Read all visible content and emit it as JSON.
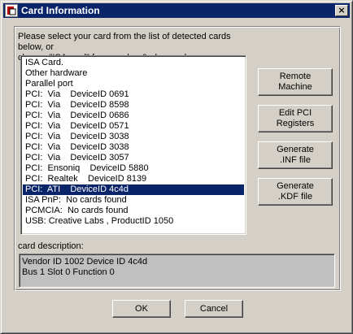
{
  "window": {
    "title": "Card Information",
    "close_glyph": "×",
    "icon": "app-icon",
    "colors": {
      "titlebar": "#0a246a",
      "selection": "#0a246a",
      "face": "#d4d0c8"
    }
  },
  "instructions": "Please select your card from the list of detected cards below, or\nchoose \"ISA card\" for non plug & play cards.",
  "cards": [
    {
      "label": "ISA Card.",
      "selected": false
    },
    {
      "label": "Other hardware",
      "selected": false
    },
    {
      "label": "Parallel port",
      "selected": false
    },
    {
      "label": "PCI:  Via    DeviceID 0691",
      "selected": false
    },
    {
      "label": "PCI:  Via    DeviceID 8598",
      "selected": false
    },
    {
      "label": "PCI:  Via    DeviceID 0686",
      "selected": false
    },
    {
      "label": "PCI:  Via    DeviceID 0571",
      "selected": false
    },
    {
      "label": "PCI:  Via    DeviceID 3038",
      "selected": false
    },
    {
      "label": "PCI:  Via    DeviceID 3038",
      "selected": false
    },
    {
      "label": "PCI:  Via    DeviceID 3057",
      "selected": false
    },
    {
      "label": "PCI:  Ensoniq    DeviceID 5880",
      "selected": false
    },
    {
      "label": "PCI:  Realtek    DeviceID 8139",
      "selected": false
    },
    {
      "label": "PCI:  ATI    DeviceID 4c4d",
      "selected": true
    },
    {
      "label": "ISA PnP:  No cards found",
      "selected": false
    },
    {
      "label": "PCMCIA:  No cards found",
      "selected": false
    },
    {
      "label": "USB: Creative Labs , ProductID 1050",
      "selected": false
    }
  ],
  "side_buttons": {
    "remote": "Remote\nMachine",
    "edit_pci": "Edit PCI\nRegisters",
    "gen_inf": "Generate\n.INF file",
    "gen_kdf": "Generate\n.KDF file"
  },
  "description": {
    "label": "card description:",
    "line1": "Vendor ID 1002 Device ID 4c4d",
    "line2": "Bus 1 Slot 0 Function 0"
  },
  "footer": {
    "ok": "OK",
    "cancel": "Cancel"
  }
}
